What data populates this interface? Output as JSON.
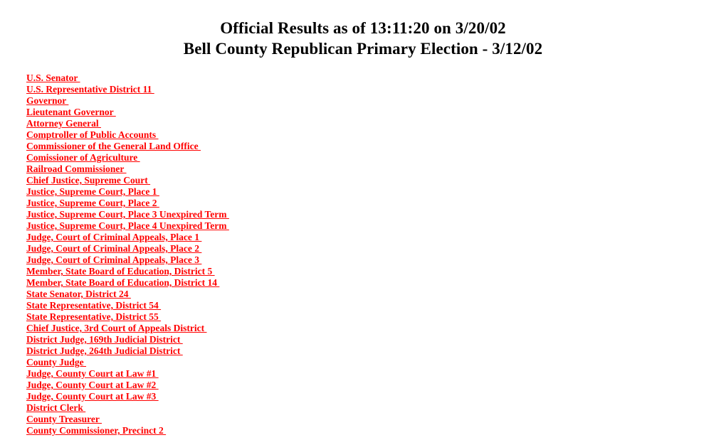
{
  "page": {
    "background_color": "#ffffff",
    "link_color": "#FF0000",
    "heading_color": "#000000"
  },
  "heading": {
    "line1": "Official Results as of 13:11:20 on 3/20/02",
    "line2": "Bell County Republican Primary Election - 3/12/02"
  },
  "contests": [
    {
      "label": "U.S. Senator "
    },
    {
      "label": "U.S. Representative District 11 "
    },
    {
      "label": "Governor "
    },
    {
      "label": "Lieutenant Governor "
    },
    {
      "label": "Attorney General "
    },
    {
      "label": "Comptroller of Public Accounts "
    },
    {
      "label": "Commissioner of the General Land Office "
    },
    {
      "label": "Comissioner of Agriculture "
    },
    {
      "label": "Railroad Commissioner "
    },
    {
      "label": "Chief Justice, Supreme Court "
    },
    {
      "label": "Justice, Supreme Court, Place 1 "
    },
    {
      "label": "Justice, Supreme Court, Place 2 "
    },
    {
      "label": "Justice, Supreme Court, Place 3 Unexpired Term "
    },
    {
      "label": "Justice, Supreme Court, Place 4 Unexpired Term "
    },
    {
      "label": "Judge, Court of Criminal Appeals, Place 1 "
    },
    {
      "label": "Judge, Court of Criminal Appeals, Place 2 "
    },
    {
      "label": "Judge, Court of Criminal Appeals, Place 3 "
    },
    {
      "label": "Member, State Board of Education, District 5 "
    },
    {
      "label": "Member, State Board of Education, District 14 "
    },
    {
      "label": "State Senator, District 24 "
    },
    {
      "label": "State Representative, District 54 "
    },
    {
      "label": "State Representative, District 55 "
    },
    {
      "label": "Chief Justice, 3rd Court of Appeals District "
    },
    {
      "label": "District Judge, 169th Judicial District "
    },
    {
      "label": "District Judge, 264th Judicial District "
    },
    {
      "label": "County Judge "
    },
    {
      "label": "Judge, County Court at Law #1 "
    },
    {
      "label": "Judge, County Court at Law #2 "
    },
    {
      "label": "Judge, County Court at Law #3 "
    },
    {
      "label": "District Clerk "
    },
    {
      "label": "County Treasurer "
    },
    {
      "label": "County Commissioner, Precinct 2 "
    }
  ]
}
